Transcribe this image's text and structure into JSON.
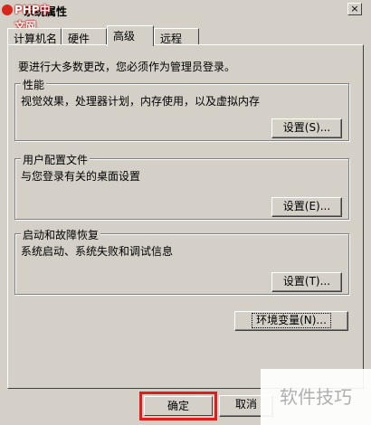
{
  "window": {
    "title": "系统属性",
    "logo_text": "PHP中文网",
    "close_label": "×"
  },
  "tabs": [
    {
      "label": "计算机名"
    },
    {
      "label": "硬件"
    },
    {
      "label": "高级",
      "active": true
    },
    {
      "label": "远程"
    }
  ],
  "intro": "要进行大多数更改，您必须作为管理员登录。",
  "groups": {
    "performance": {
      "title": "性能",
      "desc": "视觉效果，处理器计划，内存使用，以及虚拟内存",
      "button": "设置(S)..."
    },
    "profile": {
      "title": "用户配置文件",
      "desc": "与您登录有关的桌面设置",
      "button": "设置(E)..."
    },
    "startup": {
      "title": "启动和故障恢复",
      "desc": "系统启动、系统失败和调试信息",
      "button": "设置(T)..."
    }
  },
  "env_button": "环境变量(N)...",
  "footer": {
    "ok": "确定",
    "cancel": "取消"
  },
  "watermark": "软件技巧",
  "colors": {
    "highlight_border": "#e01c1c",
    "dialog_bg": "#d4d0c8"
  }
}
